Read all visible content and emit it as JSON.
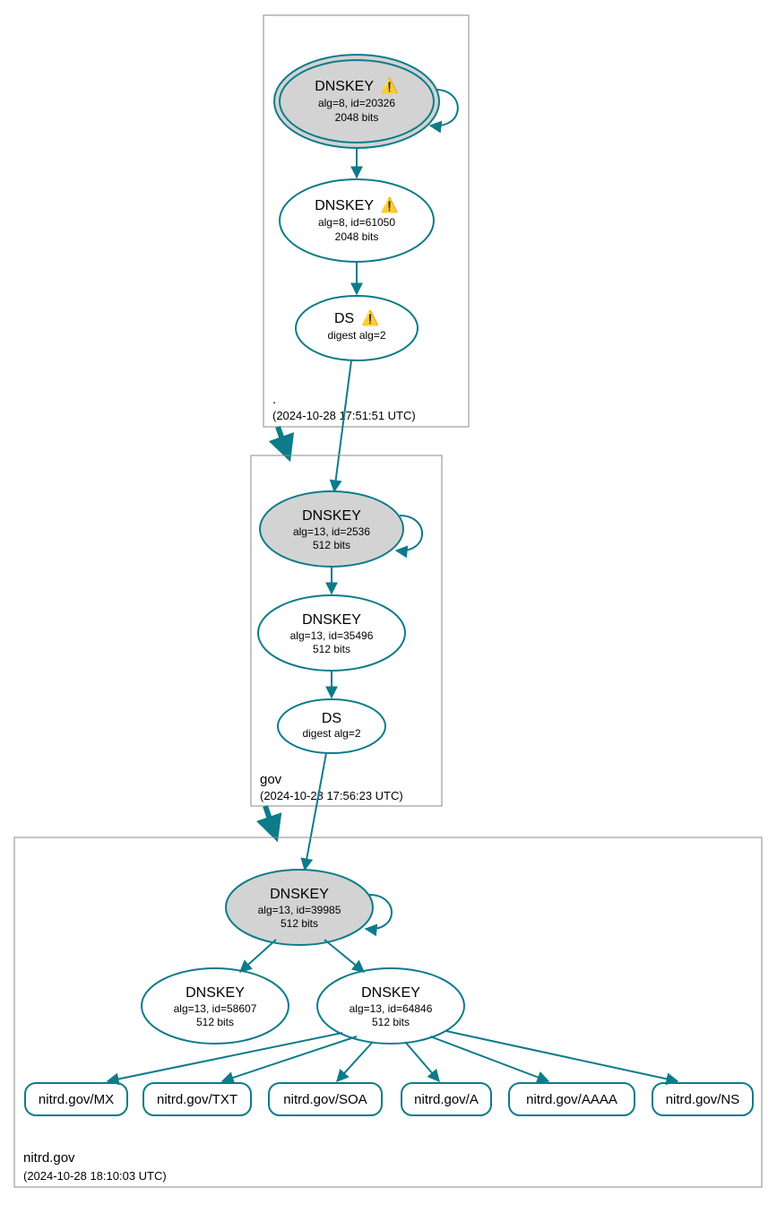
{
  "zones": {
    "root": {
      "name": ".",
      "timestamp": "(2024-10-28 17:51:51 UTC)",
      "nodes": {
        "ksk": {
          "title": "DNSKEY",
          "warn": "⚠️",
          "line2": "alg=8, id=20326",
          "line3": "2048 bits"
        },
        "zsk": {
          "title": "DNSKEY",
          "warn": "⚠️",
          "line2": "alg=8, id=61050",
          "line3": "2048 bits"
        },
        "ds": {
          "title": "DS",
          "warn": "⚠️",
          "line2": "digest alg=2"
        }
      }
    },
    "gov": {
      "name": "gov",
      "timestamp": "(2024-10-28 17:56:23 UTC)",
      "nodes": {
        "ksk": {
          "title": "DNSKEY",
          "line2": "alg=13, id=2536",
          "line3": "512 bits"
        },
        "zsk": {
          "title": "DNSKEY",
          "line2": "alg=13, id=35496",
          "line3": "512 bits"
        },
        "ds": {
          "title": "DS",
          "line2": "digest alg=2"
        }
      }
    },
    "nitrd": {
      "name": "nitrd.gov",
      "timestamp": "(2024-10-28 18:10:03 UTC)",
      "nodes": {
        "ksk": {
          "title": "DNSKEY",
          "line2": "alg=13, id=39985",
          "line3": "512 bits"
        },
        "zskA": {
          "title": "DNSKEY",
          "line2": "alg=13, id=58607",
          "line3": "512 bits"
        },
        "zskB": {
          "title": "DNSKEY",
          "line2": "alg=13, id=64846",
          "line3": "512 bits"
        }
      },
      "records": {
        "mx": "nitrd.gov/MX",
        "txt": "nitrd.gov/TXT",
        "soa": "nitrd.gov/SOA",
        "a": "nitrd.gov/A",
        "aaaa": "nitrd.gov/AAAA",
        "ns": "nitrd.gov/NS"
      }
    }
  }
}
